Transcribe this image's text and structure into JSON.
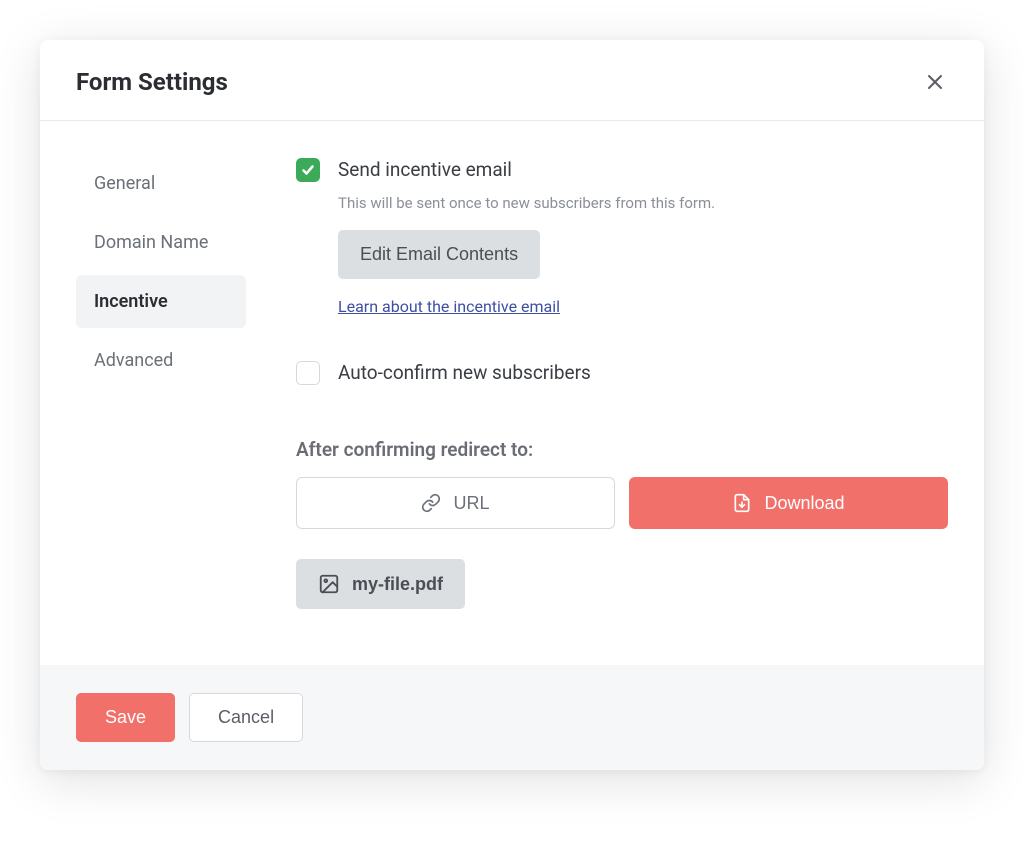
{
  "modal": {
    "title": "Form Settings"
  },
  "sidebar": {
    "items": [
      {
        "label": "General",
        "active": false
      },
      {
        "label": "Domain Name",
        "active": false
      },
      {
        "label": "Incentive",
        "active": true
      },
      {
        "label": "Advanced",
        "active": false
      }
    ]
  },
  "incentive": {
    "send_checkbox_checked": true,
    "send_label": "Send incentive email",
    "send_desc": "This will be sent once to new subscribers from this form.",
    "edit_button": "Edit Email Contents",
    "learn_link": "Learn about the incentive email",
    "auto_confirm_checked": false,
    "auto_confirm_label": "Auto-confirm new subscribers",
    "redirect_heading": "After confirming redirect to:",
    "url_button": "URL",
    "download_button": "Download",
    "file_name": "my-file.pdf"
  },
  "footer": {
    "save": "Save",
    "cancel": "Cancel"
  }
}
